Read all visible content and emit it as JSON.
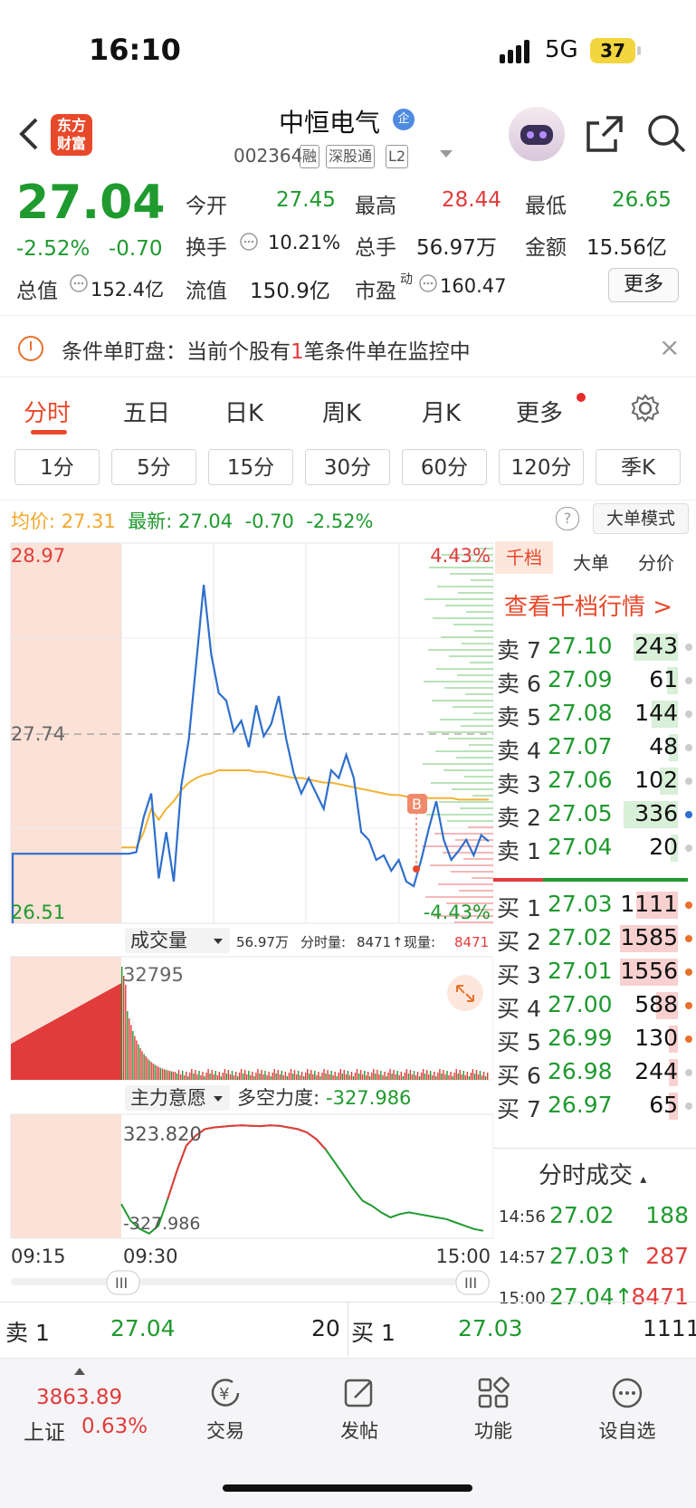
{
  "status": {
    "time": "16:10",
    "network": "5G",
    "battery": "37"
  },
  "header": {
    "logo_line1": "东方",
    "logo_line2": "财富",
    "stock_name": "中恒电气",
    "badge": "企",
    "code": "002364",
    "tags": [
      "融",
      "深股通",
      "L2"
    ]
  },
  "quote": {
    "price": "27.04",
    "change_pct": "-2.52%",
    "change": "-0.70",
    "open_label": "今开",
    "open": "27.45",
    "high_label": "最高",
    "high": "28.44",
    "low_label": "最低",
    "low": "26.65",
    "turnover_label": "换手",
    "turnover": "10.21%",
    "volume_label": "总手",
    "volume": "56.97万",
    "amount_label": "金额",
    "amount": "15.56亿",
    "mktcap_label": "总值",
    "mktcap": "152.4亿",
    "float_label": "流值",
    "float": "150.9亿",
    "pe_label": "市盈",
    "pe_sup": "动",
    "pe": "160.47",
    "more": "更多"
  },
  "alert": {
    "text_a": "条件单盯盘：当前个股有",
    "count": "1",
    "text_b": "笔条件单在监控中",
    "close": "×"
  },
  "tabs": [
    "分时",
    "五日",
    "日K",
    "周K",
    "月K",
    "更多"
  ],
  "periods": [
    "1分",
    "5分",
    "15分",
    "30分",
    "60分",
    "120分",
    "季K"
  ],
  "avg_bar": {
    "avg_label": "均价:",
    "avg": "27.31",
    "latest_label": "最新:",
    "latest": "27.04",
    "chg": "-0.70",
    "pct": "-2.52%",
    "help": "?",
    "mode": "大单模式"
  },
  "chart_data": {
    "type": "line",
    "title": "分时",
    "price_axis": {
      "max": "28.97",
      "mid": "27.74",
      "min": "26.51",
      "pct_max": "4.43%",
      "pct_min": "-4.43%"
    },
    "ylim": [
      26.51,
      28.97
    ],
    "prev_close": 27.74,
    "series": [
      {
        "name": "price",
        "values": [
          26.96,
          26.96,
          26.97,
          27.2,
          27.35,
          26.8,
          27.1,
          26.78,
          27.4,
          27.7,
          28.2,
          28.7,
          28.25,
          28.0,
          27.95,
          27.75,
          27.82,
          27.65,
          27.92,
          27.72,
          27.8,
          27.98,
          27.7,
          27.48,
          27.35,
          27.45,
          27.35,
          27.25,
          27.5,
          27.45,
          27.6,
          27.45,
          27.1,
          27.05,
          26.92,
          26.95,
          26.85,
          26.92,
          26.78,
          26.75,
          26.92,
          27.12,
          27.3,
          27.05,
          26.92,
          26.98,
          27.05,
          26.95,
          27.08,
          27.04
        ]
      },
      {
        "name": "avg",
        "values": [
          27.0,
          27.0,
          27.0,
          27.1,
          27.25,
          27.18,
          27.25,
          27.3,
          27.37,
          27.42,
          27.45,
          27.47,
          27.48,
          27.5,
          27.5,
          27.5,
          27.5,
          27.5,
          27.49,
          27.49,
          27.48,
          27.47,
          27.46,
          27.45,
          27.45,
          27.44,
          27.43,
          27.42,
          27.42,
          27.41,
          27.4,
          27.39,
          27.38,
          27.37,
          27.36,
          27.35,
          27.34,
          27.34,
          27.33,
          27.33,
          27.33,
          27.32,
          27.32,
          27.32,
          27.32,
          27.31,
          27.31,
          27.31,
          27.31,
          27.31
        ]
      }
    ],
    "time_axis": [
      "09:15",
      "09:30",
      "15:00"
    ],
    "volume_panel": {
      "label": "成交量",
      "total": "56.97万",
      "minute_label": "分时量:",
      "minute": "8471",
      "current_label": "现量:",
      "current": "8471",
      "max_label": "32795"
    },
    "capital_panel": {
      "label": "主力意愿",
      "force_label": "多空力度:",
      "force": "-327.986",
      "max_label": "323.820",
      "min_label": "-327.986",
      "values": [
        -150,
        -250,
        -300,
        -327,
        -280,
        -120,
        50,
        200,
        260,
        300,
        310,
        315,
        320,
        323,
        320,
        318,
        323,
        320,
        310,
        300,
        280,
        240,
        180,
        100,
        20,
        -60,
        -130,
        -160,
        -200,
        -230,
        -210,
        -200,
        -210,
        -220,
        -230,
        -240,
        -260,
        -280,
        -300,
        -310
      ]
    }
  },
  "orderbook": {
    "tabs": [
      "千档",
      "大单",
      "分价"
    ],
    "link": "查看千档行情 >",
    "asks": [
      {
        "label": "卖 7",
        "price": "27.10",
        "vol": "243"
      },
      {
        "label": "卖 6",
        "price": "27.09",
        "vol": "61"
      },
      {
        "label": "卖 5",
        "price": "27.08",
        "vol": "144"
      },
      {
        "label": "卖 4",
        "price": "27.07",
        "vol": "48"
      },
      {
        "label": "卖 3",
        "price": "27.06",
        "vol": "102"
      },
      {
        "label": "卖 2",
        "price": "27.05",
        "vol": "336"
      },
      {
        "label": "卖 1",
        "price": "27.04",
        "vol": "20"
      }
    ],
    "bids": [
      {
        "label": "买 1",
        "price": "27.03",
        "vol": "1111"
      },
      {
        "label": "买 2",
        "price": "27.02",
        "vol": "1585"
      },
      {
        "label": "买 3",
        "price": "27.01",
        "vol": "1556"
      },
      {
        "label": "买 4",
        "price": "27.00",
        "vol": "588"
      },
      {
        "label": "买 5",
        "price": "26.99",
        "vol": "130"
      },
      {
        "label": "买 6",
        "price": "26.98",
        "vol": "244"
      },
      {
        "label": "买 7",
        "price": "26.97",
        "vol": "65"
      }
    ],
    "ticks_title": "分时成交",
    "ticks": [
      {
        "time": "14:56",
        "price": "27.02",
        "vol": "188"
      },
      {
        "time": "14:57",
        "price": "27.03↑",
        "vol": "287"
      },
      {
        "time": "15:00",
        "price": "27.04↑",
        "vol": "8471"
      }
    ]
  },
  "strip": {
    "ask_label": "卖 1",
    "ask_price": "27.04",
    "ask_vol": "20",
    "bid_label": "买 1",
    "bid_price": "27.03",
    "bid_vol": "1111"
  },
  "nav": {
    "index_value": "3863.89",
    "index_name": "上证",
    "index_pct": "0.63%",
    "items": [
      "交易",
      "发帖",
      "功能",
      "设自选"
    ]
  },
  "colors": {
    "up": "#e23b3b",
    "down": "#1f9a2f",
    "accent": "#e8492b",
    "price_line": "#2e6fcc",
    "avg_line": "#f2b233"
  }
}
